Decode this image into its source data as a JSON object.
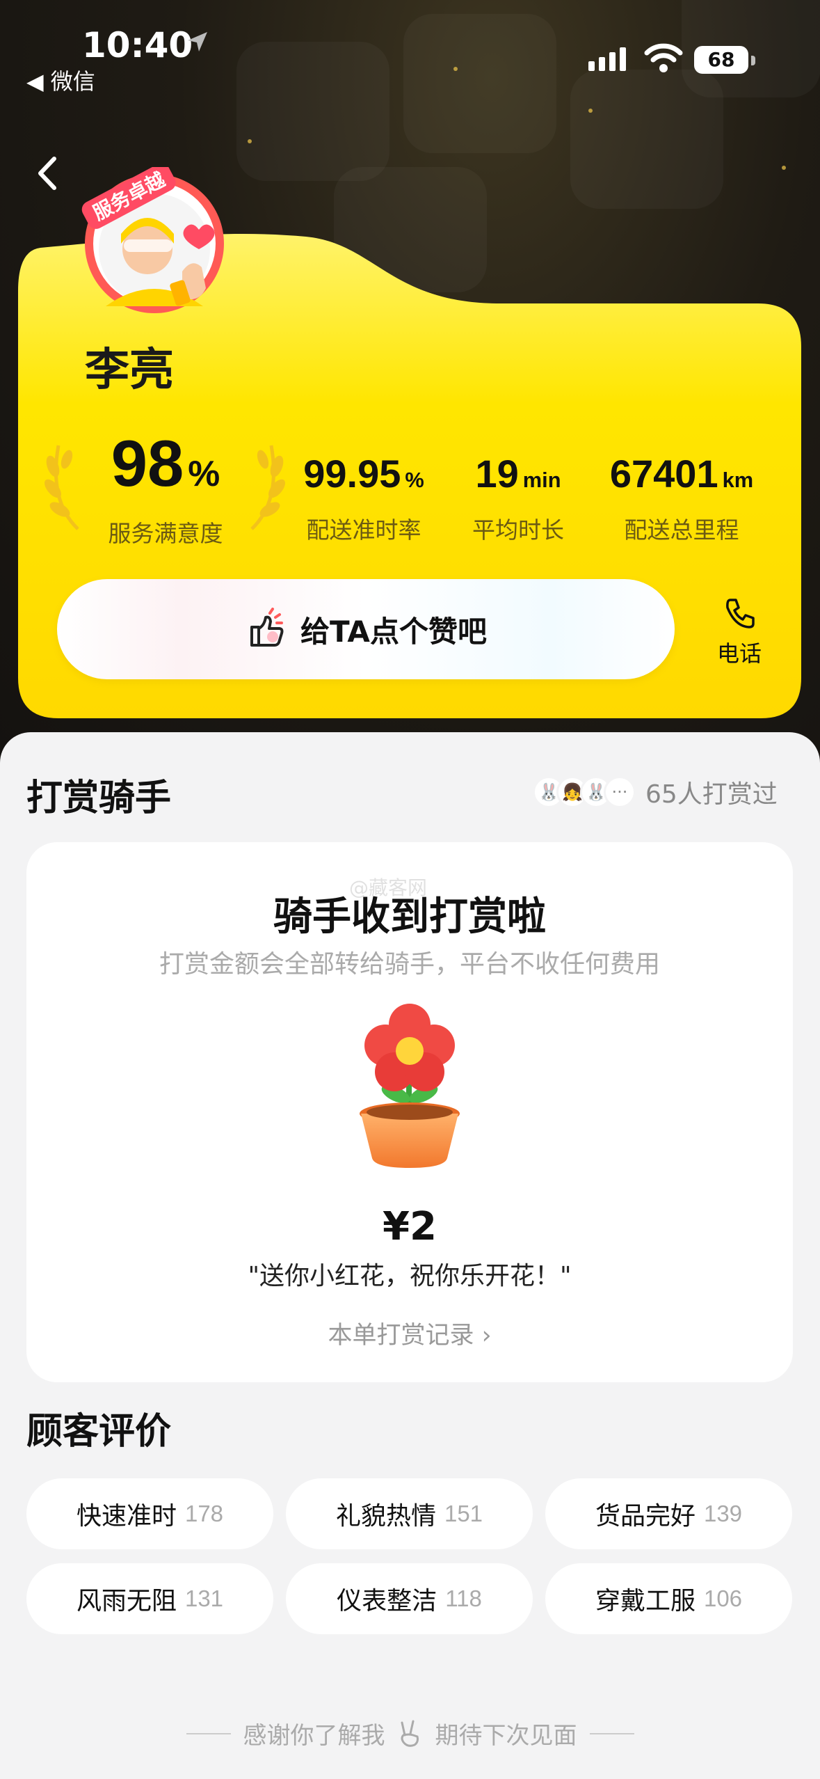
{
  "status_bar": {
    "time": "10:40",
    "back_app": "◀ 微信",
    "battery": "68"
  },
  "rider": {
    "name": "李亮",
    "badge": "服务卓越"
  },
  "stats": [
    {
      "value": "98",
      "unit": "%",
      "label": "服务满意度"
    },
    {
      "value": "99.95",
      "unit": "%",
      "label": "配送准时率"
    },
    {
      "value": "19",
      "unit": "min",
      "label": "平均时长"
    },
    {
      "value": "67401",
      "unit": "km",
      "label": "配送总里程"
    }
  ],
  "actions": {
    "like": "给TA点个赞吧",
    "phone": "电话"
  },
  "tip_section": {
    "title": "打赏骑手",
    "tipper_count": "65人打赏过",
    "card_title": "骑手收到打赏啦",
    "card_subtitle": "打赏金额会全部转给骑手，平台不收任何费用",
    "amount": "¥2",
    "message": "\"送你小红花，祝你乐开花！\"",
    "record_link": "本单打赏记录 ›"
  },
  "reviews": {
    "title": "顾客评价",
    "tags": [
      {
        "label": "快速准时",
        "count": "178"
      },
      {
        "label": "礼貌热情",
        "count": "151"
      },
      {
        "label": "货品完好",
        "count": "139"
      },
      {
        "label": "风雨无阻",
        "count": "131"
      },
      {
        "label": "仪表整洁",
        "count": "118"
      },
      {
        "label": "穿戴工服",
        "count": "106"
      }
    ]
  },
  "footer": {
    "left": "感谢你了解我",
    "right": "期待下次见面"
  },
  "watermark": "@藏客网",
  "colors": {
    "yellow": "#ffe100",
    "dark_bg": "#1f1b14",
    "panel": "#f3f3f4"
  }
}
